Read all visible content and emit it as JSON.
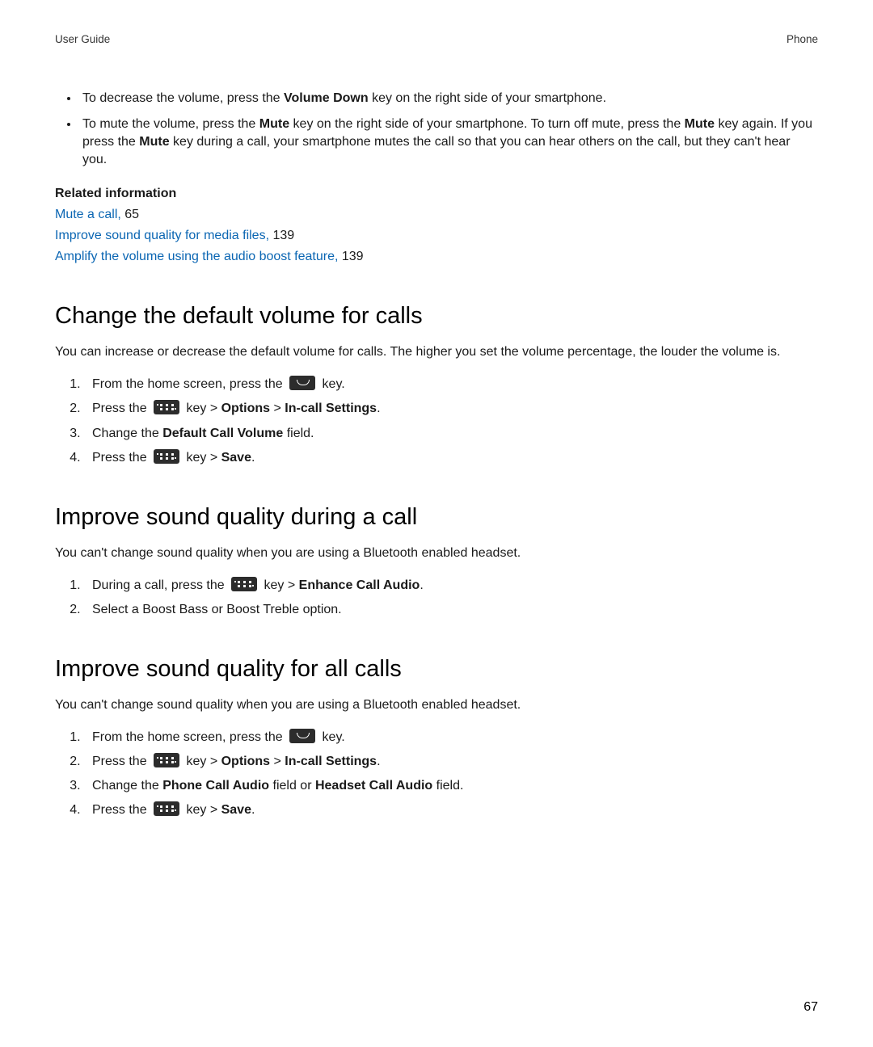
{
  "header": {
    "left": "User Guide",
    "right": "Phone"
  },
  "top_bullets": [
    {
      "segments": [
        {
          "t": "To decrease the volume, press the "
        },
        {
          "t": "Volume Down",
          "b": true
        },
        {
          "t": " key on the right side of your smartphone."
        }
      ]
    },
    {
      "segments": [
        {
          "t": "To mute the volume, press the "
        },
        {
          "t": "Mute",
          "b": true
        },
        {
          "t": " key on the right side of your smartphone. To turn off mute, press the "
        },
        {
          "t": "Mute",
          "b": true
        },
        {
          "t": " key again. If you press the "
        },
        {
          "t": "Mute",
          "b": true
        },
        {
          "t": " key during a call, your smartphone mutes the call so that you can hear others on the call, but they can't hear you."
        }
      ]
    }
  ],
  "related": {
    "heading": "Related information",
    "items": [
      {
        "link": "Mute a call,",
        "page": " 65"
      },
      {
        "link": "Improve sound quality for media files,",
        "page": " 139"
      },
      {
        "link": "Amplify the volume using the audio boost feature,",
        "page": " 139"
      }
    ]
  },
  "sec1": {
    "title": "Change the default volume for calls",
    "intro": "You can increase or decrease the default volume for calls. The higher you set the volume percentage, the louder the volume is.",
    "steps": [
      {
        "segments": [
          {
            "t": "From the home screen, press the "
          },
          {
            "icon": "phone"
          },
          {
            "t": " key."
          }
        ]
      },
      {
        "segments": [
          {
            "t": "Press the "
          },
          {
            "icon": "menu"
          },
          {
            "t": " key > "
          },
          {
            "t": "Options",
            "b": true
          },
          {
            "t": " > "
          },
          {
            "t": "In-call Settings",
            "b": true
          },
          {
            "t": "."
          }
        ]
      },
      {
        "segments": [
          {
            "t": "Change the "
          },
          {
            "t": "Default Call Volume",
            "b": true
          },
          {
            "t": " field."
          }
        ]
      },
      {
        "segments": [
          {
            "t": "Press the "
          },
          {
            "icon": "menu"
          },
          {
            "t": " key > "
          },
          {
            "t": "Save",
            "b": true
          },
          {
            "t": "."
          }
        ]
      }
    ]
  },
  "sec2": {
    "title": "Improve sound quality during a call",
    "intro": "You can't change sound quality when you are using a Bluetooth enabled headset.",
    "steps": [
      {
        "segments": [
          {
            "t": "During a call, press the "
          },
          {
            "icon": "menu"
          },
          {
            "t": " key > "
          },
          {
            "t": "Enhance Call Audio",
            "b": true
          },
          {
            "t": "."
          }
        ]
      },
      {
        "segments": [
          {
            "t": "Select a Boost Bass or Boost Treble option."
          }
        ]
      }
    ]
  },
  "sec3": {
    "title": "Improve sound quality for all calls",
    "intro": "You can't change sound quality when you are using a Bluetooth enabled headset.",
    "steps": [
      {
        "segments": [
          {
            "t": "From the home screen, press the "
          },
          {
            "icon": "phone"
          },
          {
            "t": " key."
          }
        ]
      },
      {
        "segments": [
          {
            "t": "Press the "
          },
          {
            "icon": "menu"
          },
          {
            "t": " key > "
          },
          {
            "t": "Options",
            "b": true
          },
          {
            "t": " > "
          },
          {
            "t": "In-call Settings",
            "b": true
          },
          {
            "t": "."
          }
        ]
      },
      {
        "segments": [
          {
            "t": "Change the "
          },
          {
            "t": "Phone Call Audio",
            "b": true
          },
          {
            "t": " field or "
          },
          {
            "t": "Headset Call Audio",
            "b": true
          },
          {
            "t": " field."
          }
        ]
      },
      {
        "segments": [
          {
            "t": "Press the "
          },
          {
            "icon": "menu"
          },
          {
            "t": " key > "
          },
          {
            "t": "Save",
            "b": true
          },
          {
            "t": "."
          }
        ]
      }
    ]
  },
  "page_number": "67"
}
